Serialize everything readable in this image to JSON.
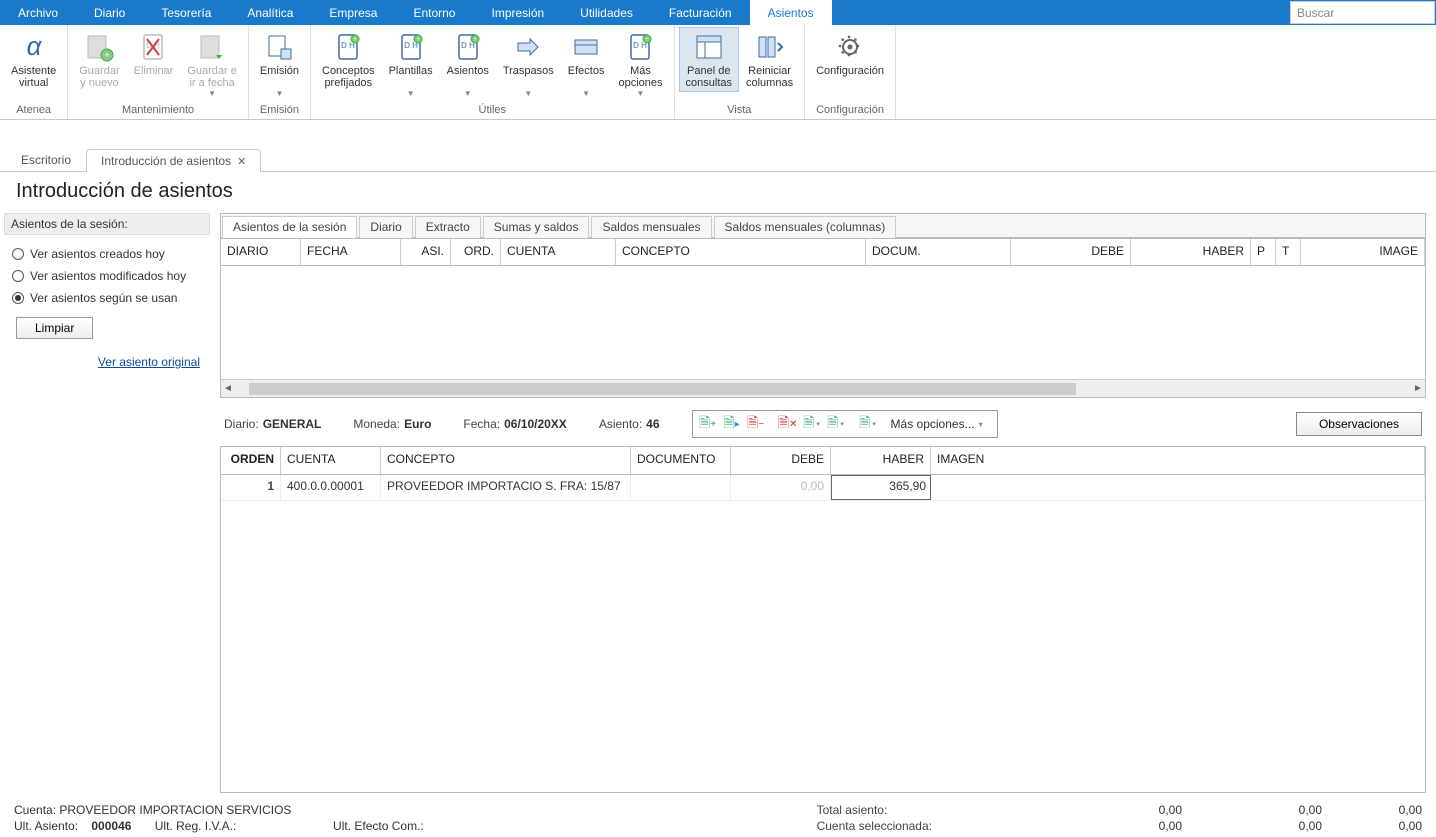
{
  "menu": {
    "items": [
      "Archivo",
      "Diario",
      "Tesorería",
      "Analítica",
      "Empresa",
      "Entorno",
      "Impresión",
      "Utilidades",
      "Facturación",
      "Asientos"
    ],
    "active": 9,
    "search_placeholder": "Buscar"
  },
  "ribbon": {
    "groups": [
      {
        "label": "Atenea",
        "buttons": [
          {
            "name": "asistente-virtual",
            "lines": [
              "Asistente",
              "virtual"
            ],
            "icon": "alpha"
          }
        ]
      },
      {
        "label": "Mantenimiento",
        "buttons": [
          {
            "name": "guardar-y-nuevo",
            "lines": [
              "Guardar",
              "y nuevo"
            ],
            "icon": "save-new",
            "disabled": true
          },
          {
            "name": "eliminar",
            "lines": [
              "Eliminar",
              ""
            ],
            "icon": "delete",
            "disabled": true
          },
          {
            "name": "guardar-ir-fecha",
            "lines": [
              "Guardar e",
              "ir a fecha"
            ],
            "icon": "save-goto",
            "disabled": true,
            "drop": true
          }
        ]
      },
      {
        "label": "Emisión",
        "buttons": [
          {
            "name": "emision",
            "lines": [
              "Emisión",
              ""
            ],
            "icon": "emit",
            "drop": true
          }
        ]
      },
      {
        "label": "Útiles",
        "buttons": [
          {
            "name": "conceptos-prefijados",
            "lines": [
              "Conceptos",
              "prefijados"
            ],
            "icon": "doc-dh"
          },
          {
            "name": "plantillas",
            "lines": [
              "Plantillas",
              ""
            ],
            "icon": "doc-dh",
            "drop": true
          },
          {
            "name": "asientos-dd",
            "lines": [
              "Asientos",
              ""
            ],
            "icon": "doc-dh",
            "drop": true
          },
          {
            "name": "traspasos",
            "lines": [
              "Traspasos",
              ""
            ],
            "icon": "traspasos",
            "drop": true
          },
          {
            "name": "efectos",
            "lines": [
              "Efectos",
              ""
            ],
            "icon": "efectos",
            "drop": true
          },
          {
            "name": "mas-opciones",
            "lines": [
              "Más",
              "opciones"
            ],
            "icon": "doc-dh",
            "drop": true
          }
        ]
      },
      {
        "label": "Vista",
        "buttons": [
          {
            "name": "panel-consultas",
            "lines": [
              "Panel de",
              "consultas"
            ],
            "icon": "panel",
            "pressed": true
          },
          {
            "name": "reiniciar-columnas",
            "lines": [
              "Reiniciar",
              "columnas"
            ],
            "icon": "reset-cols"
          }
        ]
      },
      {
        "label": "Configuración",
        "buttons": [
          {
            "name": "configuracion",
            "lines": [
              "Configuración",
              ""
            ],
            "icon": "gear"
          }
        ]
      }
    ]
  },
  "doc_tabs": {
    "items": [
      {
        "label": "Escritorio",
        "active": false
      },
      {
        "label": "Introducción de asientos",
        "active": true,
        "closable": true
      }
    ]
  },
  "page_title": "Introducción de asientos",
  "side": {
    "header": "Asientos de la sesión:",
    "radios": [
      {
        "label": "Ver asientos creados hoy",
        "selected": false
      },
      {
        "label": "Ver asientos modificados hoy",
        "selected": false
      },
      {
        "label": "Ver asientos según se usan",
        "selected": true
      }
    ],
    "limpiar": "Limpiar",
    "link": "Ver asiento original"
  },
  "inner_tabs": [
    "Asientos de la sesión",
    "Diario",
    "Extracto",
    "Sumas y saldos",
    "Saldos mensuales",
    "Saldos mensuales (columnas)"
  ],
  "session_grid_cols": [
    "DIARIO",
    "FECHA",
    "ASI.",
    "ORD.",
    "CUENTA",
    "CONCEPTO",
    "DOCUM.",
    "DEBE",
    "HABER",
    "P",
    "T",
    "IMAGE"
  ],
  "info": {
    "diario_l": "Diario:",
    "diario_v": "GENERAL",
    "moneda_l": "Moneda:",
    "moneda_v": "Euro",
    "fecha_l": "Fecha:",
    "fecha_v": "06/10/20XX",
    "asiento_l": "Asiento:",
    "asiento_v": "46",
    "more": "Más opciones...",
    "obs": "Observaciones"
  },
  "entry_cols": [
    "ORDEN",
    "CUENTA",
    "CONCEPTO",
    "DOCUMENTO",
    "DEBE",
    "HABER",
    "IMAGEN"
  ],
  "entry_row": {
    "orden": "1",
    "cuenta": "400.0.0.00001",
    "concepto": "PROVEEDOR IMPORTACIO S. FRA:  15/87",
    "documento": "",
    "debe": "0,00",
    "haber": "365,90"
  },
  "status": {
    "cuenta_l": "Cuenta:",
    "cuenta_v": "PROVEEDOR IMPORTACION SERVICIOS",
    "ult_asiento_l": "Ult. Asiento:",
    "ult_asiento_v": "000046",
    "ult_reg_l": "Ult. Reg. I.V.A.:",
    "ult_reg_v": "",
    "ult_ef_l": "Ult. Efecto Com.:",
    "ult_ef_v": "",
    "total_l": "Total asiento:",
    "sel_l": "Cuenta seleccionada:",
    "n": [
      "0,00",
      "0,00",
      "0,00",
      "0,00",
      "0,00",
      "0,00"
    ]
  }
}
